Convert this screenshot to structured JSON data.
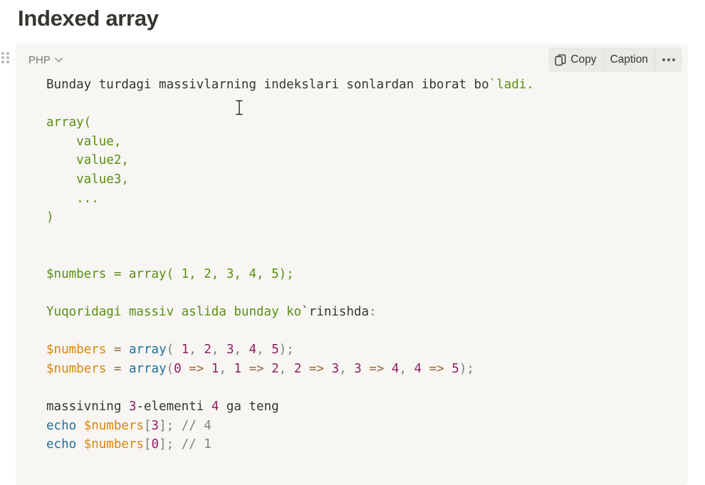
{
  "page": {
    "title": "Indexed array"
  },
  "code_block": {
    "language": "PHP",
    "toolbar": {
      "copy_label": "Copy",
      "caption_label": "Caption"
    },
    "colors": {
      "string": "#5a8f11",
      "keyword": "#1f6f9a",
      "variable": "#d9860b",
      "number": "#8e1f63",
      "operator": "#9a6a3a",
      "punctuation": "#7f7f7f",
      "plain": "#37352f",
      "background": "#f7f6f3"
    },
    "lines": [
      [
        {
          "t": "Bunday turdagi massivlarning indekslari sonlardan iborat bo",
          "c": "plain"
        },
        {
          "t": "`ladi.",
          "c": "str"
        }
      ],
      [],
      [
        {
          "t": "array(",
          "c": "str"
        }
      ],
      [
        {
          "t": "    value,",
          "c": "str"
        }
      ],
      [
        {
          "t": "    value2,",
          "c": "str"
        }
      ],
      [
        {
          "t": "    value3,",
          "c": "str"
        }
      ],
      [
        {
          "t": "    ...",
          "c": "str"
        }
      ],
      [
        {
          "t": ")",
          "c": "str"
        }
      ],
      [],
      [],
      [
        {
          "t": "$numbers = array( 1, 2, 3, 4, 5);",
          "c": "str"
        }
      ],
      [],
      [
        {
          "t": "Yuqoridagi massiv aslida bunday ko",
          "c": "str"
        },
        {
          "t": "`rinishda",
          "c": "plain"
        },
        {
          "t": ":",
          "c": "pun"
        }
      ],
      [],
      [
        {
          "t": "$numbers",
          "c": "var"
        },
        {
          "t": " ",
          "c": "plain"
        },
        {
          "t": "=",
          "c": "op"
        },
        {
          "t": " ",
          "c": "plain"
        },
        {
          "t": "array",
          "c": "kw"
        },
        {
          "t": "(",
          "c": "pun"
        },
        {
          "t": " ",
          "c": "plain"
        },
        {
          "t": "1",
          "c": "num"
        },
        {
          "t": ", ",
          "c": "pun"
        },
        {
          "t": "2",
          "c": "num"
        },
        {
          "t": ", ",
          "c": "pun"
        },
        {
          "t": "3",
          "c": "num"
        },
        {
          "t": ", ",
          "c": "pun"
        },
        {
          "t": "4",
          "c": "num"
        },
        {
          "t": ", ",
          "c": "pun"
        },
        {
          "t": "5",
          "c": "num"
        },
        {
          "t": ");",
          "c": "pun"
        }
      ],
      [
        {
          "t": "$numbers",
          "c": "var"
        },
        {
          "t": " ",
          "c": "plain"
        },
        {
          "t": "=",
          "c": "op"
        },
        {
          "t": " ",
          "c": "plain"
        },
        {
          "t": "array",
          "c": "kw"
        },
        {
          "t": "(",
          "c": "pun"
        },
        {
          "t": "0",
          "c": "num"
        },
        {
          "t": " ",
          "c": "plain"
        },
        {
          "t": "=>",
          "c": "op"
        },
        {
          "t": " ",
          "c": "plain"
        },
        {
          "t": "1",
          "c": "num"
        },
        {
          "t": ", ",
          "c": "pun"
        },
        {
          "t": "1",
          "c": "num"
        },
        {
          "t": " ",
          "c": "plain"
        },
        {
          "t": "=>",
          "c": "op"
        },
        {
          "t": " ",
          "c": "plain"
        },
        {
          "t": "2",
          "c": "num"
        },
        {
          "t": ", ",
          "c": "pun"
        },
        {
          "t": "2",
          "c": "num"
        },
        {
          "t": " ",
          "c": "plain"
        },
        {
          "t": "=>",
          "c": "op"
        },
        {
          "t": " ",
          "c": "plain"
        },
        {
          "t": "3",
          "c": "num"
        },
        {
          "t": ", ",
          "c": "pun"
        },
        {
          "t": "3",
          "c": "num"
        },
        {
          "t": " ",
          "c": "plain"
        },
        {
          "t": "=>",
          "c": "op"
        },
        {
          "t": " ",
          "c": "plain"
        },
        {
          "t": "4",
          "c": "num"
        },
        {
          "t": ", ",
          "c": "pun"
        },
        {
          "t": "4",
          "c": "num"
        },
        {
          "t": " ",
          "c": "plain"
        },
        {
          "t": "=>",
          "c": "op"
        },
        {
          "t": " ",
          "c": "plain"
        },
        {
          "t": "5",
          "c": "num"
        },
        {
          "t": ");",
          "c": "pun"
        }
      ],
      [],
      [
        {
          "t": "massivning ",
          "c": "plain"
        },
        {
          "t": "3",
          "c": "num"
        },
        {
          "t": "-elementi ",
          "c": "plain"
        },
        {
          "t": "4",
          "c": "num"
        },
        {
          "t": " ga teng",
          "c": "plain"
        }
      ],
      [
        {
          "t": "echo",
          "c": "kw"
        },
        {
          "t": " ",
          "c": "plain"
        },
        {
          "t": "$numbers",
          "c": "var"
        },
        {
          "t": "[",
          "c": "pun"
        },
        {
          "t": "3",
          "c": "num"
        },
        {
          "t": "]; // 4",
          "c": "pun"
        }
      ],
      [
        {
          "t": "echo",
          "c": "kw"
        },
        {
          "t": " ",
          "c": "plain"
        },
        {
          "t": "$numbers",
          "c": "var"
        },
        {
          "t": "[",
          "c": "pun"
        },
        {
          "t": "0",
          "c": "num"
        },
        {
          "t": "]; // 1",
          "c": "pun"
        }
      ]
    ]
  }
}
